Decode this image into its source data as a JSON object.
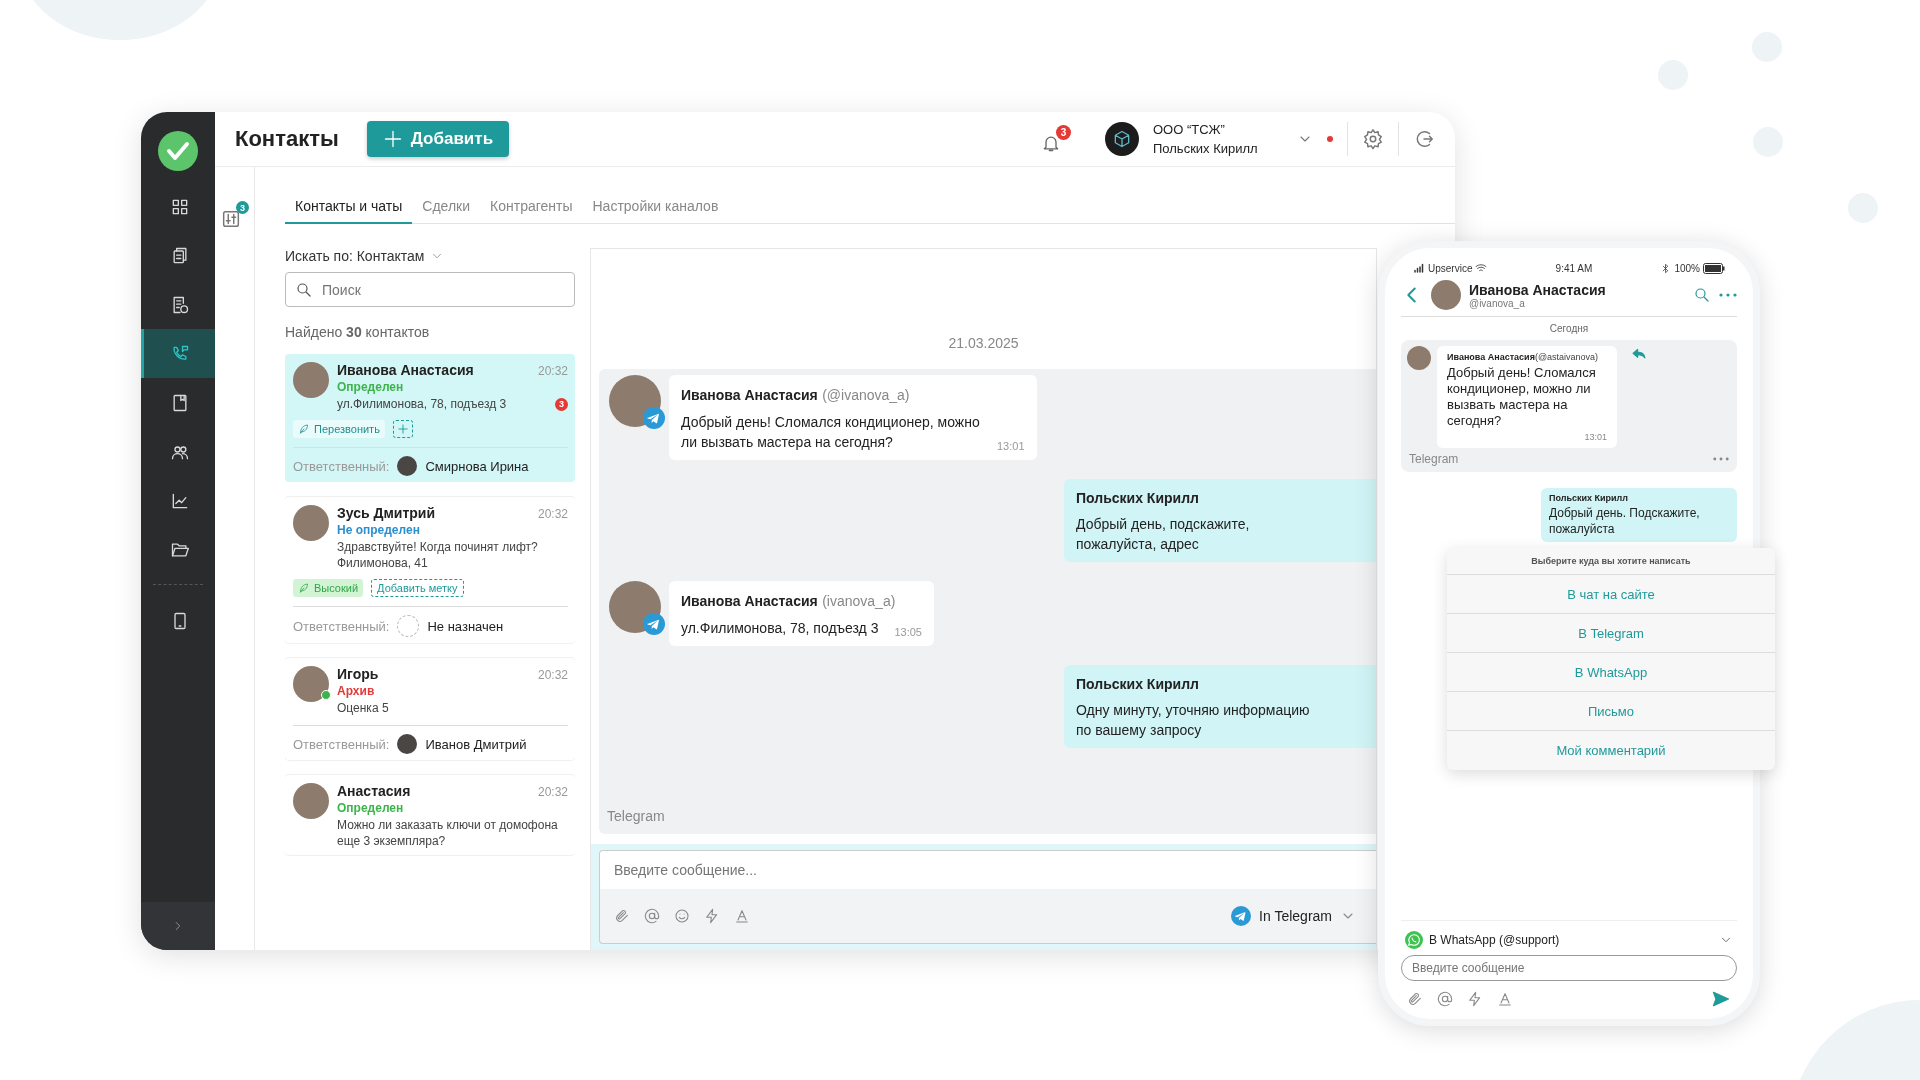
{
  "sidebar": {
    "items": [
      {
        "kind": "grid",
        "selected": false
      },
      {
        "kind": "clipboard",
        "selected": false
      },
      {
        "kind": "report",
        "selected": false
      },
      {
        "kind": "calls",
        "selected": true
      },
      {
        "kind": "book",
        "selected": false
      },
      {
        "kind": "people",
        "selected": false
      },
      {
        "kind": "chart",
        "selected": false
      },
      {
        "kind": "folder",
        "selected": false
      },
      {
        "kind": "tablet",
        "selected": false
      }
    ]
  },
  "header": {
    "title": "Контакты",
    "add_button": "Добавить",
    "notifications": "3",
    "org": "ООО “ТСЖ”",
    "user": "Польских Кирилл"
  },
  "filter_badge": "3",
  "tabs": [
    {
      "label": "Контакты и чаты",
      "selected": true
    },
    {
      "label": "Сделки",
      "selected": false
    },
    {
      "label": "Контрагенты",
      "selected": false
    },
    {
      "label": "Настройки каналов",
      "selected": false
    }
  ],
  "contacts": {
    "search_by": "Искать по: Контактам",
    "search_placeholder": "Поиск",
    "found": "Найдено **30** контактов",
    "cards": [
      {
        "name": "Иванова Анастасия",
        "time": "20:32",
        "status": "Определен",
        "color": "#3cb44b",
        "message": "ул.Филимонова, 78, подъезд 3",
        "unread": "3",
        "online": false,
        "selected": true,
        "tags": [
          {
            "kind": "callback",
            "label": "Перезвонить"
          },
          {
            "kind": "add-icon"
          }
        ],
        "responsible_label": "Ответственный:",
        "responsible": "Смирнова Ирина",
        "assigned": true
      },
      {
        "name": "Зусь Дмитрий",
        "time": "20:32",
        "status": "Не определен",
        "color": "#2a8fd0",
        "message": "Здравствуйте! Когда починят лифт? Филимонова, 41",
        "online": false,
        "selected": false,
        "tags": [
          {
            "kind": "priority",
            "label": "Высокий"
          },
          {
            "kind": "add",
            "label": "Добавить метку"
          }
        ],
        "responsible_label": "Ответственный:",
        "responsible": "Не назначен",
        "assigned": false
      },
      {
        "name": "Игорь",
        "time": "20:32",
        "status": "Архив",
        "color": "#e53935",
        "message": "Оценка 5",
        "online": true,
        "selected": false,
        "responsible_label": "Ответственный:",
        "responsible": "Иванов Дмитрий",
        "assigned": true
      },
      {
        "name": "Анастасия",
        "time": "20:32",
        "status": "Определен",
        "color": "#3cb44b",
        "message": "Можно ли заказать ключи от домофона еще 3 экземпляра?",
        "online": false,
        "selected": false
      }
    ]
  },
  "chat": {
    "date": "21.03.2025",
    "messages": [
      {
        "kind": "incoming",
        "author": "Иванова Анастасия",
        "handle": "(@ivanova_a)",
        "text": "Добрый день! Сломался кондиционер, можно ли вызвать мастера на сегодня?",
        "time": "13:01"
      },
      {
        "kind": "outgoing",
        "author": "Польских Кирилл",
        "text": "Добрый день, подскажите, пожалуйста, адрес"
      },
      {
        "kind": "incoming",
        "author": "Иванова Анастасия",
        "handle": "(ivanova_a)",
        "text": "ул.Филимонова, 78, подъезд 3",
        "time": "13:05"
      },
      {
        "kind": "outgoing",
        "author": "Польских Кирилл",
        "text": "Одну минуту, уточняю информацию по вашему запросу"
      }
    ],
    "channel": "Telegram",
    "input_placeholder": "Введите сообщение...",
    "send_via": "In Telegram"
  },
  "phone": {
    "carrier": "Upservice",
    "clock": "9:41 AM",
    "battery": "100%",
    "contact": {
      "name": "Иванова Анастасия",
      "handle": "@ivanova_a"
    },
    "day": "Сегодня",
    "message": {
      "author": "Иванова Анастасия",
      "handle": "(@astaivanova)",
      "text": "Добрый день! Сломался кондиционер, можно ли вызвать мастера на сегодня?",
      "time": "13:01"
    },
    "channel": "Telegram",
    "reply": {
      "author": "Польских Кирилл",
      "text": "Добрый день. Подскажите, пожалуйста"
    },
    "sheet": {
      "title": "Выберите куда вы хотите написать",
      "options": [
        "В чат на сайте",
        "В Telegram",
        "В WhatsApp",
        "Письмо",
        "Мой комментарий"
      ]
    },
    "channel_select": "В WhatsApp (@support)",
    "input_placeholder": "Введите сообщение"
  }
}
